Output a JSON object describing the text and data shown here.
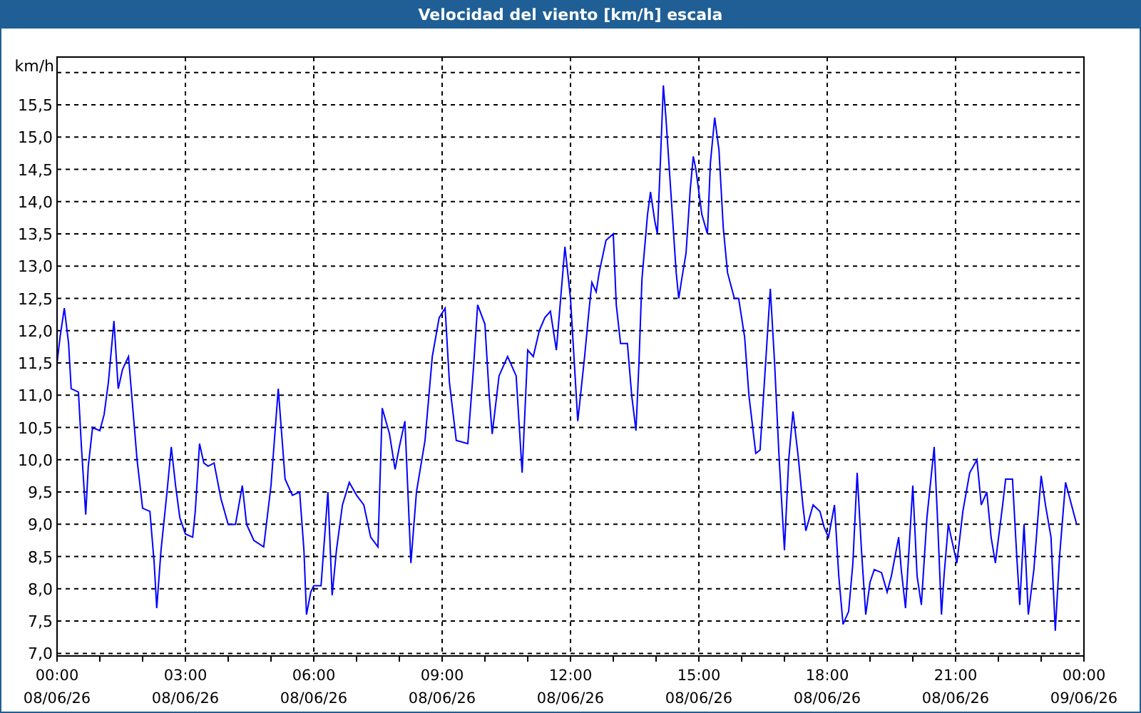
{
  "window": {
    "title": "Velocidad del viento [km/h] escala"
  },
  "chart": {
    "chart_data": {
      "type": "line",
      "grid": true,
      "ylabel": "km/h",
      "xlim": [
        0,
        24
      ],
      "xticks": [
        {
          "value": 0,
          "label": "00:00"
        },
        {
          "value": 3,
          "label": "03:00"
        },
        {
          "value": 6,
          "label": "06:00"
        },
        {
          "value": 9,
          "label": "09:00"
        },
        {
          "value": 12,
          "label": "12:00"
        },
        {
          "value": 15,
          "label": "15:00"
        },
        {
          "value": 18,
          "label": "18:00"
        },
        {
          "value": 21,
          "label": "21:00"
        },
        {
          "value": 24,
          "label": "00:00"
        }
      ],
      "ylim": [
        6.96,
        16.24
      ],
      "yticks": [
        {
          "value": 7,
          "label": "7,0"
        },
        {
          "value": 7.5,
          "label": "7,5"
        },
        {
          "value": 8,
          "label": "8,0"
        },
        {
          "value": 8.5,
          "label": "8,5"
        },
        {
          "value": 9,
          "label": "9,0"
        },
        {
          "value": 9.5,
          "label": "9,5"
        },
        {
          "value": 10,
          "label": "10,0"
        },
        {
          "value": 10.5,
          "label": "10,5"
        },
        {
          "value": 11,
          "label": "11,0"
        },
        {
          "value": 11.5,
          "label": "11,5"
        },
        {
          "value": 12,
          "label": "12,0"
        },
        {
          "value": 12.5,
          "label": "12,5"
        },
        {
          "value": 13,
          "label": "13,0"
        },
        {
          "value": 13.5,
          "label": "13,5"
        },
        {
          "value": 14,
          "label": "14,0"
        },
        {
          "value": 14.5,
          "label": "14,5"
        },
        {
          "value": 15,
          "label": "15,0"
        },
        {
          "value": 15.5,
          "label": "15,5"
        }
      ],
      "x": [
        0,
        0.07,
        0.17,
        0.27,
        0.33,
        0.5,
        0.57,
        0.67,
        0.73,
        0.83,
        1.0,
        1.1,
        1.2,
        1.33,
        1.43,
        1.53,
        1.67,
        1.77,
        1.87,
        2.0,
        2.17,
        2.27,
        2.33,
        2.43,
        2.57,
        2.67,
        2.77,
        2.87,
        3.0,
        3.17,
        3.23,
        3.33,
        3.43,
        3.53,
        3.67,
        3.83,
        4.0,
        4.17,
        4.33,
        4.43,
        4.6,
        4.83,
        5.0,
        5.17,
        5.33,
        5.5,
        5.67,
        5.77,
        5.83,
        5.93,
        6.0,
        6.17,
        6.27,
        6.33,
        6.43,
        6.53,
        6.67,
        6.83,
        7.0,
        7.17,
        7.33,
        7.5,
        7.6,
        7.77,
        7.9,
        8.0,
        8.13,
        8.27,
        8.4,
        8.6,
        8.77,
        8.93,
        9.07,
        9.17,
        9.33,
        9.6,
        9.73,
        9.83,
        10.0,
        10.1,
        10.17,
        10.33,
        10.53,
        10.73,
        10.87,
        11.0,
        11.13,
        11.27,
        11.4,
        11.53,
        11.67,
        11.77,
        11.87,
        12.0,
        12.17,
        12.33,
        12.43,
        12.5,
        12.6,
        12.67,
        12.83,
        13.0,
        13.07,
        13.17,
        13.33,
        13.43,
        13.53,
        13.6,
        13.67,
        13.8,
        13.87,
        13.97,
        14.03,
        14.1,
        14.17,
        14.23,
        14.33,
        14.47,
        14.53,
        14.6,
        14.7,
        14.8,
        14.87,
        14.93,
        15.07,
        15.2,
        15.27,
        15.37,
        15.47,
        15.57,
        15.67,
        15.83,
        15.93,
        16.07,
        16.17,
        16.33,
        16.43,
        16.57,
        16.67,
        16.77,
        16.87,
        17.0,
        17.1,
        17.2,
        17.33,
        17.43,
        17.5,
        17.67,
        17.83,
        17.93,
        18.03,
        18.17,
        18.27,
        18.37,
        18.5,
        18.6,
        18.7,
        18.8,
        18.9,
        19.0,
        19.1,
        19.27,
        19.4,
        19.5,
        19.67,
        19.73,
        19.83,
        20.0,
        20.1,
        20.2,
        20.33,
        20.5,
        20.57,
        20.67,
        20.73,
        20.83,
        20.93,
        21.03,
        21.17,
        21.33,
        21.5,
        21.6,
        21.73,
        21.83,
        21.93,
        22.1,
        22.17,
        22.33,
        22.43,
        22.5,
        22.6,
        22.7,
        22.83,
        23.0,
        23.1,
        23.23,
        23.33,
        23.43,
        23.57,
        23.67,
        23.83
      ],
      "series": [
        {
          "color": "#0000ff",
          "values": [
            11.5,
            11.9,
            12.35,
            11.8,
            11.1,
            11.05,
            10.2,
            9.15,
            9.9,
            10.5,
            10.45,
            10.7,
            11.2,
            12.15,
            11.1,
            11.4,
            11.6,
            10.8,
            10.0,
            9.25,
            9.2,
            8.4,
            7.7,
            8.6,
            9.5,
            10.2,
            9.6,
            9.1,
            8.85,
            8.8,
            9.2,
            10.25,
            9.95,
            9.9,
            9.95,
            9.4,
            9.0,
            9.0,
            9.6,
            9.0,
            8.75,
            8.65,
            9.6,
            11.1,
            9.7,
            9.45,
            9.5,
            8.6,
            7.6,
            7.95,
            8.05,
            8.05,
            8.95,
            9.5,
            7.9,
            8.6,
            9.3,
            9.65,
            9.45,
            9.3,
            8.8,
            8.65,
            10.8,
            10.4,
            9.85,
            10.2,
            10.6,
            8.4,
            9.5,
            10.3,
            11.6,
            12.2,
            12.35,
            11.2,
            10.3,
            10.25,
            11.4,
            12.4,
            12.1,
            11.0,
            10.4,
            11.3,
            11.6,
            11.3,
            9.8,
            11.7,
            11.6,
            12.0,
            12.2,
            12.3,
            11.7,
            12.5,
            13.3,
            12.5,
            10.6,
            11.6,
            12.3,
            12.75,
            12.6,
            12.9,
            13.4,
            13.5,
            12.4,
            11.8,
            11.8,
            11.0,
            10.45,
            11.5,
            12.8,
            13.8,
            14.15,
            13.7,
            13.5,
            14.6,
            15.8,
            15.3,
            14.3,
            12.9,
            12.5,
            12.8,
            13.2,
            14.2,
            14.7,
            14.5,
            13.8,
            13.5,
            14.6,
            15.3,
            14.8,
            13.6,
            12.9,
            12.5,
            12.5,
            11.9,
            11.0,
            10.1,
            10.15,
            11.6,
            12.65,
            11.5,
            10.1,
            8.6,
            10.0,
            10.75,
            10.0,
            9.3,
            8.9,
            9.3,
            9.2,
            8.95,
            8.8,
            9.3,
            8.2,
            7.45,
            7.65,
            8.4,
            9.8,
            8.6,
            7.6,
            8.1,
            8.3,
            8.25,
            7.95,
            8.2,
            8.8,
            8.3,
            7.7,
            9.6,
            8.2,
            7.75,
            9.1,
            10.2,
            9.2,
            7.6,
            8.2,
            9.0,
            8.7,
            8.4,
            9.2,
            9.8,
            10.0,
            9.3,
            9.5,
            8.8,
            8.4,
            9.3,
            9.7,
            9.7,
            8.5,
            7.75,
            9.0,
            7.6,
            8.3,
            9.75,
            9.3,
            8.8,
            7.35,
            8.5,
            9.65,
            9.4,
            9.0
          ]
        }
      ]
    },
    "x_axis_dates": [
      "08/06/26",
      "08/06/26",
      "08/06/26",
      "08/06/26",
      "08/06/26",
      "08/06/26",
      "08/06/26",
      "08/06/26",
      "09/06/26"
    ]
  }
}
